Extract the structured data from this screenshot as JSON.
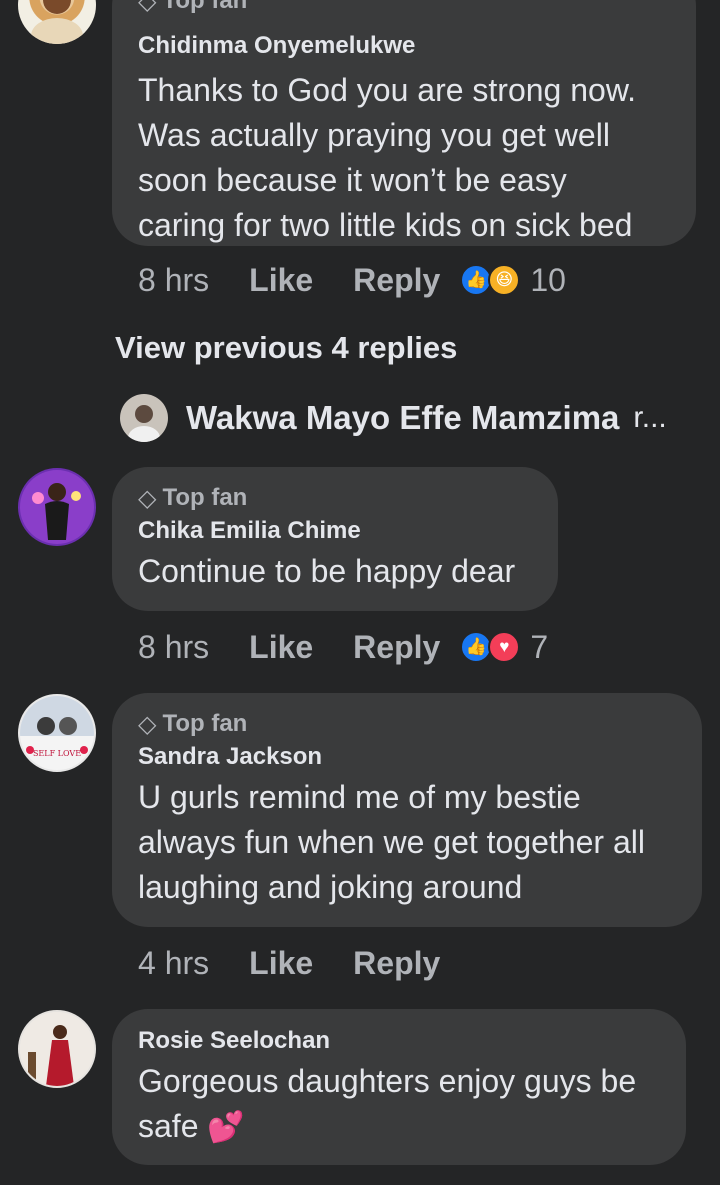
{
  "comments": [
    {
      "top_fan": "Top fan",
      "name": "Chidinma Onyemelukwe",
      "lines": [
        "Thanks to God you are strong now.",
        "Was actually praying you get well",
        "soon because it won’t be easy",
        "caring for two little kids on sick bed"
      ],
      "time": "8 hrs",
      "like": "Like",
      "reply": "Reply",
      "reactions": [
        "like-icon",
        "haha-icon"
      ],
      "reaction_count": "10"
    },
    {
      "top_fan": "Top fan",
      "name": "Chika Emilia Chime",
      "lines": [
        "Continue to be happy dear"
      ],
      "time": "8 hrs",
      "like": "Like",
      "reply": "Reply",
      "reactions": [
        "like-icon",
        "love-icon"
      ],
      "reaction_count": "7"
    },
    {
      "top_fan": "Top fan",
      "name": "Sandra Jackson",
      "lines": [
        "U gurls remind me of my bestie",
        "always fun when we get together all",
        "laughing and joking around"
      ],
      "time": "4 hrs",
      "like": "Like",
      "reply": "Reply"
    },
    {
      "name": "Rosie Seelochan",
      "lines": [
        "Gorgeous daughters enjoy guys be",
        "safe"
      ],
      "emoji": "💕"
    }
  ],
  "view_previous": "View previous 4 replies",
  "reply_preview": {
    "name": "Wakwa Mayo Effe Mamzima",
    "suffix": "r..."
  },
  "colors": {
    "background": "#242526",
    "bubble": "#3a3b3c",
    "like_blue": "#1877f2",
    "love_red": "#f33e58",
    "haha_yellow": "#f7b125"
  }
}
